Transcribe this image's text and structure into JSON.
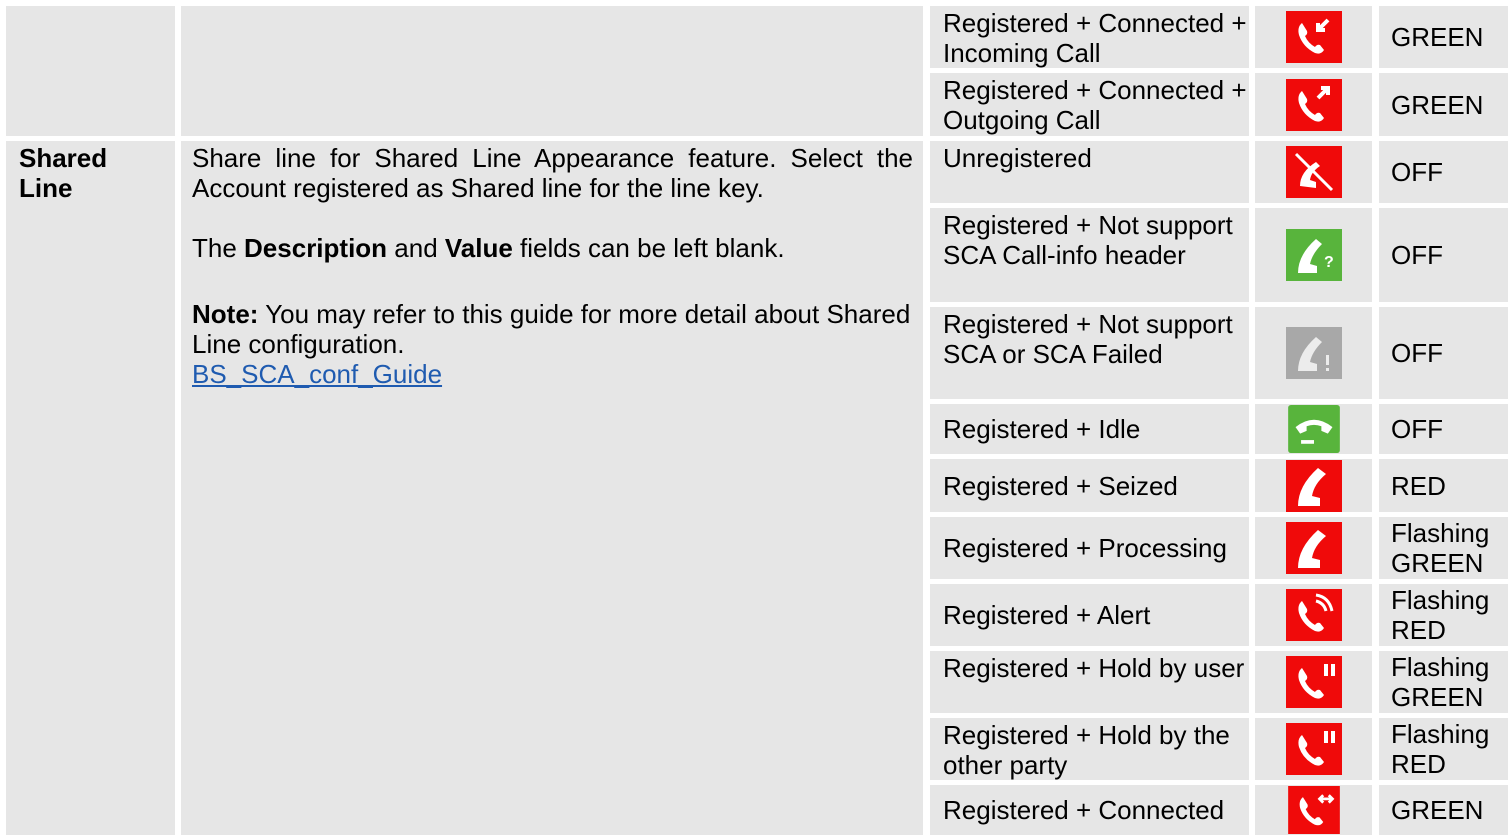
{
  "colors": {
    "cell_bg": "#e6e6e6",
    "red": "#f00a0a",
    "green": "#58b43c",
    "gray": "#a8a8a8",
    "link": "#1f5bb0"
  },
  "left": {
    "name": "Shared Line"
  },
  "description": {
    "p1": "Share line for Shared Line Appearance feature. Select the Account registered as Shared line for the line key.",
    "p2_prefix": "The ",
    "p2_bold1": "Description",
    "p2_mid": " and ",
    "p2_bold2": "Value",
    "p2_suffix": " fields can be left blank.",
    "note_label": "Note:",
    "note_text": " You may refer to this guide for more detail about Shared Line configuration.",
    "link": "BS_SCA_conf_Guide"
  },
  "top_rows": [
    {
      "status": "Registered + Connected + Incoming Call",
      "icon": "incoming-call-icon",
      "led": "GREEN"
    },
    {
      "status": "Registered + Connected + Outgoing Call",
      "icon": "outgoing-call-icon",
      "led": "GREEN"
    }
  ],
  "rows": [
    {
      "status": "Unregistered",
      "icon": "phone-unregistered-icon",
      "led": "OFF"
    },
    {
      "status": "Registered + Not support SCA Call-info header",
      "icon": "phone-question-icon",
      "led": "OFF"
    },
    {
      "status": "Registered + Not support SCA or SCA Failed",
      "icon": "phone-failed-icon",
      "led": "OFF"
    },
    {
      "status": "Registered + Idle",
      "icon": "phone-idle-icon",
      "led": "OFF"
    },
    {
      "status": "Registered + Seized",
      "icon": "phone-seized-icon",
      "led": "RED"
    },
    {
      "status": "Registered + Processing",
      "icon": "phone-processing-icon",
      "led": "Flashing GREEN"
    },
    {
      "status": "Registered + Alert",
      "icon": "phone-alert-icon",
      "led": "Flashing RED"
    },
    {
      "status": "Registered + Hold by user",
      "icon": "phone-hold-user-icon",
      "led": "Flashing GREEN"
    },
    {
      "status": "Registered + Hold by the other party",
      "icon": "phone-hold-other-icon",
      "led": "Flashing RED"
    },
    {
      "status": "Registered + Connected",
      "icon": "phone-connected-icon",
      "led": "GREEN"
    }
  ]
}
